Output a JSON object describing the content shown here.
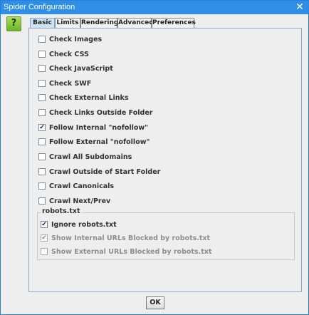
{
  "window": {
    "title": "Spider Configuration",
    "close_glyph": "✕"
  },
  "help_button": {
    "label": "?"
  },
  "tabs": [
    {
      "label": "Basic",
      "active": true
    },
    {
      "label": "Limits",
      "active": false
    },
    {
      "label": "Rendering",
      "active": false
    },
    {
      "label": "Advanced",
      "active": false
    },
    {
      "label": "Preferences",
      "active": false
    }
  ],
  "options": [
    {
      "label": "Check Images",
      "checked": false
    },
    {
      "label": "Check CSS",
      "checked": false
    },
    {
      "label": "Check JavaScript",
      "checked": false
    },
    {
      "label": "Check SWF",
      "checked": false
    },
    {
      "label": "Check External Links",
      "checked": false
    },
    {
      "label": "Check Links Outside Folder",
      "checked": false
    },
    {
      "label": "Follow Internal \"nofollow\"",
      "checked": true
    },
    {
      "label": "Follow External \"nofollow\"",
      "checked": false
    },
    {
      "label": "Crawl All Subdomains",
      "checked": false
    },
    {
      "label": "Crawl Outside of Start Folder",
      "checked": false
    },
    {
      "label": "Crawl Canonicals",
      "checked": false
    },
    {
      "label": "Crawl Next/Prev",
      "checked": false
    }
  ],
  "robots": {
    "title": "robots.txt",
    "items": [
      {
        "label": "Ignore robots.txt",
        "checked": true,
        "enabled": true
      },
      {
        "label": "Show Internal URLs Blocked by robots.txt",
        "checked": true,
        "enabled": false
      },
      {
        "label": "Show External URLs Blocked by robots.txt",
        "checked": false,
        "enabled": false
      }
    ]
  },
  "footer": {
    "ok_label": "OK"
  },
  "check_glyph": "✔"
}
